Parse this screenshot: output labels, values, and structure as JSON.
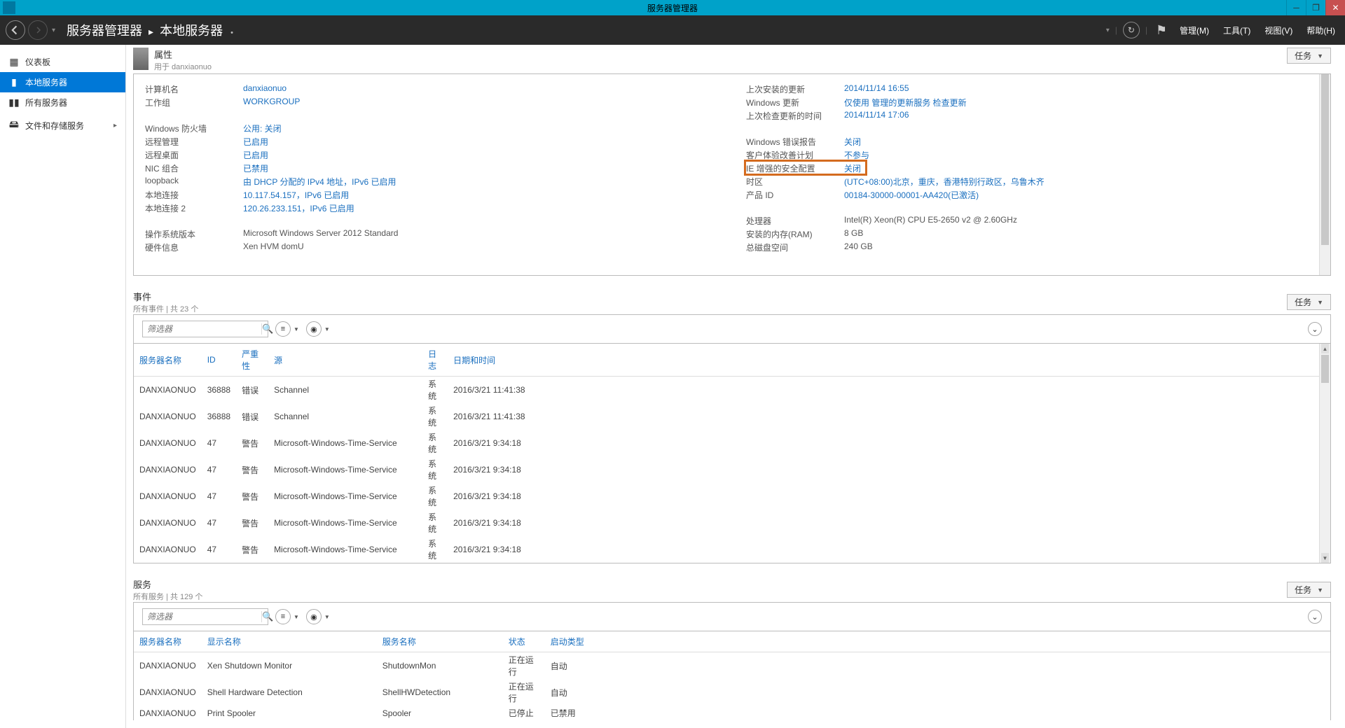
{
  "window": {
    "title": "服务器管理器",
    "minimize": "─",
    "maximize": "❐",
    "close": "✕"
  },
  "header": {
    "breadcrumb_root": "服务器管理器",
    "breadcrumb_current": "本地服务器",
    "menu_manage": "管理(M)",
    "menu_tools": "工具(T)",
    "menu_view": "视图(V)",
    "menu_help": "帮助(H)"
  },
  "sidebar": {
    "items": [
      {
        "icon": "▦",
        "label": "仪表板"
      },
      {
        "icon": "▮",
        "label": "本地服务器"
      },
      {
        "icon": "▮▮",
        "label": "所有服务器"
      },
      {
        "icon": "🖴",
        "label": "文件和存储服务",
        "chev": "▸"
      }
    ]
  },
  "properties": {
    "title": "属性",
    "subtitle": "用于 danxiaonuo",
    "tasks": "任务",
    "left": [
      {
        "group": [
          {
            "label": "计算机名",
            "value": "danxiaonuo",
            "link": true
          },
          {
            "label": "工作组",
            "value": "WORKGROUP",
            "link": true
          }
        ]
      },
      {
        "group": [
          {
            "label": "Windows 防火墙",
            "value": "公用: 关闭",
            "link": true
          },
          {
            "label": "远程管理",
            "value": "已启用",
            "link": true
          },
          {
            "label": "远程桌面",
            "value": "已启用",
            "link": true
          },
          {
            "label": "NIC 组合",
            "value": "已禁用",
            "link": true
          },
          {
            "label": "loopback",
            "value": "由 DHCP 分配的 IPv4 地址，IPv6 已启用",
            "link": true
          },
          {
            "label": "本地连接",
            "value": "10.117.54.157，IPv6 已启用",
            "link": true
          },
          {
            "label": "本地连接 2",
            "value": "120.26.233.151，IPv6 已启用",
            "link": true
          }
        ]
      },
      {
        "group": [
          {
            "label": "操作系统版本",
            "value": "Microsoft Windows Server 2012 Standard",
            "link": false
          },
          {
            "label": "硬件信息",
            "value": "Xen HVM domU",
            "link": false
          }
        ]
      }
    ],
    "right": [
      {
        "group": [
          {
            "label": "上次安装的更新",
            "value": "2014/11/14 16:55",
            "link": true
          },
          {
            "label": "Windows 更新",
            "value": "仅使用 管理的更新服务 检查更新",
            "link": true
          },
          {
            "label": "上次检查更新的时间",
            "value": "2014/11/14 17:06",
            "link": true
          }
        ]
      },
      {
        "group": [
          {
            "label": "Windows 错误报告",
            "value": "关闭",
            "link": true
          },
          {
            "label": "客户体验改善计划",
            "value": "不参与",
            "link": true
          },
          {
            "label": "IE 增强的安全配置",
            "value": "关闭",
            "link": true,
            "hl": true
          },
          {
            "label": "时区",
            "value": "(UTC+08:00)北京，重庆，香港特别行政区，乌鲁木齐",
            "link": true
          },
          {
            "label": "产品 ID",
            "value": "00184-30000-00001-AA420(已激活)",
            "link": true
          }
        ]
      },
      {
        "group": [
          {
            "label": "处理器",
            "value": "Intel(R) Xeon(R) CPU E5-2650 v2 @ 2.60GHz",
            "link": false
          },
          {
            "label": "安装的内存(RAM)",
            "value": "8 GB",
            "link": false
          },
          {
            "label": "总磁盘空间",
            "value": "240 GB",
            "link": false
          }
        ]
      }
    ]
  },
  "events": {
    "title": "事件",
    "subtitle": "所有事件 | 共 23 个",
    "tasks": "任务",
    "filter_placeholder": "筛选器",
    "columns": [
      "服务器名称",
      "ID",
      "严重性",
      "源",
      "日志",
      "日期和时间"
    ],
    "rows": [
      [
        "DANXIAONUO",
        "36888",
        "错误",
        "Schannel",
        "系统",
        "2016/3/21 11:41:38"
      ],
      [
        "DANXIAONUO",
        "36888",
        "错误",
        "Schannel",
        "系统",
        "2016/3/21 11:41:38"
      ],
      [
        "DANXIAONUO",
        "47",
        "警告",
        "Microsoft-Windows-Time-Service",
        "系统",
        "2016/3/21 9:34:18"
      ],
      [
        "DANXIAONUO",
        "47",
        "警告",
        "Microsoft-Windows-Time-Service",
        "系统",
        "2016/3/21 9:34:18"
      ],
      [
        "DANXIAONUO",
        "47",
        "警告",
        "Microsoft-Windows-Time-Service",
        "系统",
        "2016/3/21 9:34:18"
      ],
      [
        "DANXIAONUO",
        "47",
        "警告",
        "Microsoft-Windows-Time-Service",
        "系统",
        "2016/3/21 9:34:18"
      ],
      [
        "DANXIAONUO",
        "47",
        "警告",
        "Microsoft-Windows-Time-Service",
        "系统",
        "2016/3/21 9:34:18"
      ]
    ]
  },
  "services": {
    "title": "服务",
    "subtitle": "所有服务 | 共 129 个",
    "tasks": "任务",
    "filter_placeholder": "筛选器",
    "columns": [
      "服务器名称",
      "显示名称",
      "服务名称",
      "状态",
      "启动类型"
    ],
    "rows": [
      [
        "DANXIAONUO",
        "Xen Shutdown Monitor",
        "ShutdownMon",
        "正在运行",
        "自动"
      ],
      [
        "DANXIAONUO",
        "Shell Hardware Detection",
        "ShellHWDetection",
        "正在运行",
        "自动"
      ],
      [
        "DANXIAONUO",
        "Print Spooler",
        "Spooler",
        "已停止",
        "已禁用"
      ]
    ]
  }
}
